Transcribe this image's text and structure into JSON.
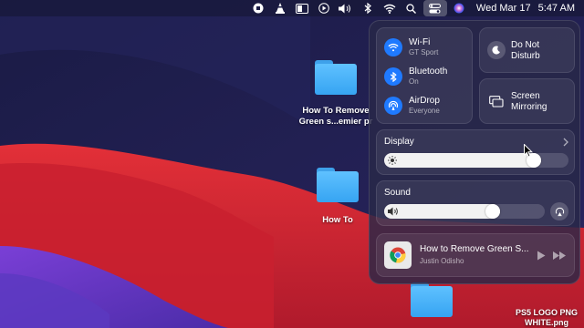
{
  "menubar": {
    "date": "Wed Mar 17",
    "time": "5:47 AM",
    "icons": [
      "record-icon",
      "vlc-cone-icon",
      "window-switcher-icon",
      "play-circle-icon",
      "volume-icon",
      "bluetooth-icon",
      "wifi-icon",
      "search-icon",
      "control-center-icon",
      "siri-icon"
    ]
  },
  "desktop": {
    "items": [
      {
        "label_line1": "How To Remove",
        "label_line2": "Green s...emier pr"
      },
      {
        "label": "How To"
      },
      {
        "label_line1": "PS5 LOGO PNG",
        "label_line2": "WHITE.png"
      }
    ]
  },
  "control_center": {
    "wifi": {
      "title": "Wi-Fi",
      "subtitle": "GT Sport",
      "icon": "wifi-icon"
    },
    "bluetooth": {
      "title": "Bluetooth",
      "subtitle": "On",
      "icon": "bluetooth-icon"
    },
    "airdrop": {
      "title": "AirDrop",
      "subtitle": "Everyone",
      "icon": "airdrop-icon"
    },
    "dnd": {
      "title_line1": "Do Not",
      "title_line2": "Disturb",
      "icon": "moon-icon"
    },
    "mirroring": {
      "title_line1": "Screen",
      "title_line2": "Mirroring",
      "icon": "screen-mirroring-icon"
    },
    "display": {
      "label": "Display",
      "level": 0.85,
      "icon": "sun-icon"
    },
    "sound": {
      "label": "Sound",
      "level": 0.72,
      "icon": "speaker-icon"
    },
    "now_playing": {
      "title": "How to Remove Green S...",
      "artist": "Justin Odisho",
      "app_icon": "chrome-icon",
      "controls": [
        "play-icon",
        "fast-forward-icon"
      ]
    }
  },
  "colors": {
    "accent": "#1f7aff",
    "folder": "#4bb3fb",
    "wallpaper_red": "#d8262f"
  }
}
